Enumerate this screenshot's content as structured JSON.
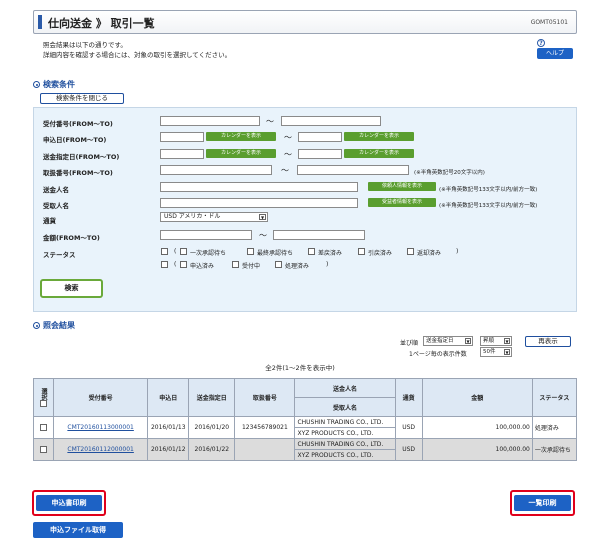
{
  "title": {
    "text": "仕向送金 》 取引一覧",
    "code": "GOMT05101"
  },
  "intro": {
    "line1": "照会結果は以下の通りです。",
    "line2": "詳細内容を確認する場合には、対象の取引を選択してください。"
  },
  "help": {
    "label": "ヘルプ",
    "icon": "?"
  },
  "search": {
    "heading": "検索条件",
    "close_label": "検索条件を閉じる",
    "fields": {
      "ref_no": "受付番号(FROM〜TO)",
      "apply_date": "申込日(FROM〜TO)",
      "send_date": "送金指定日(FROM〜TO)",
      "trade_no": "取扱番号(FROM〜TO)",
      "remitter": "送金人名",
      "beneficiary": "受取人名",
      "currency": "通貨",
      "amount": "金額(FROM〜TO)",
      "status": "ステータス"
    },
    "calendar_label": "カレンダーを表示",
    "tilde": "〜",
    "trade_note": "(※半角英数記号20文字以内)",
    "remitter_btn": "依頼人情報を表示",
    "beneficiary_btn": "受益者情報を表示",
    "name_note": "(※半角英数記号133文字以内/前方一致)",
    "currency_value": "USD アメリカ・ドル",
    "status_row1": {
      "open": "(",
      "items": [
        "一次承認待ち",
        "最終承認待ち",
        "差戻済み",
        "引戻済み",
        "返却済み"
      ],
      "close": ")"
    },
    "status_row2": {
      "open": "(",
      "items": [
        "申込済み",
        "受付中",
        "処理済み"
      ],
      "close": ")"
    },
    "search_btn": "検索"
  },
  "results": {
    "heading": "照会結果",
    "sort_label": "並び順",
    "sort_value": "送金指定日",
    "order_value": "昇順",
    "per_page_label": "1ページ毎の表示件数",
    "per_page_value": "50件",
    "redisplay": "再表示",
    "count_text": "全2件(1〜2件を表示中)",
    "headers": {
      "select": "選択",
      "ref_no": "受付番号",
      "apply_date": "申込日",
      "send_date": "送金指定日",
      "trade_no": "取扱番号",
      "remitter": "送金人名",
      "beneficiary": "受取人名",
      "currency": "通貨",
      "amount": "金額",
      "status": "ステータス"
    },
    "rows": [
      {
        "ref_no": "CMT20160113000001",
        "apply_date": "2016/01/13",
        "send_date": "2016/01/20",
        "trade_no": "123456789021",
        "remitter": "CHUSHIN TRADING CO., LTD.",
        "beneficiary": "XYZ PRODUCTS CO., LTD.",
        "currency": "USD",
        "amount": "100,000.00",
        "status": "処理済み"
      },
      {
        "ref_no": "CMT20160112000001",
        "apply_date": "2016/01/12",
        "send_date": "2016/01/22",
        "trade_no": "",
        "remitter": "CHUSHIN TRADING CO., LTD.",
        "beneficiary": "XYZ PRODUCTS CO., LTD.",
        "currency": "USD",
        "amount": "100,000.00",
        "status": "一次承認待ち"
      }
    ]
  },
  "actions": {
    "print_apply": "申込書印刷",
    "list_print": "一覧印刷",
    "get_file": "申込ファイル取得"
  }
}
